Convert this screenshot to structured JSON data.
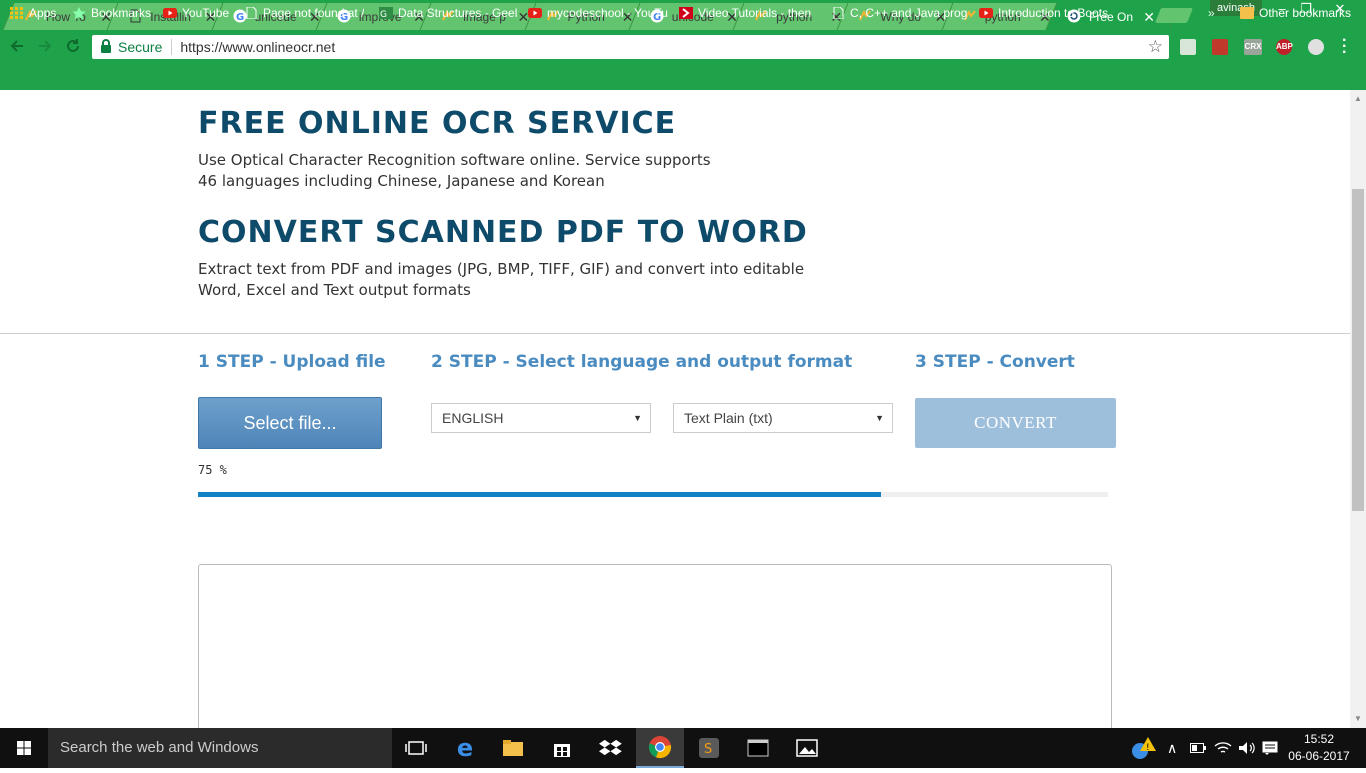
{
  "browser": {
    "tabs": [
      {
        "title": "How To",
        "icon": "python-icon",
        "active": false
      },
      {
        "title": "Installin",
        "icon": "doc-icon",
        "active": false
      },
      {
        "title": "unicode",
        "icon": "google-icon",
        "active": false
      },
      {
        "title": "improve",
        "icon": "google-icon",
        "active": false
      },
      {
        "title": "image p",
        "icon": "python-icon",
        "active": false
      },
      {
        "title": "Python",
        "icon": "python-icon",
        "active": false
      },
      {
        "title": "unicode",
        "icon": "google-icon",
        "active": false
      },
      {
        "title": "python",
        "icon": "python-icon",
        "active": false
      },
      {
        "title": "Why do",
        "icon": "python-icon",
        "active": false
      },
      {
        "title": "python",
        "icon": "python-icon",
        "active": false
      },
      {
        "title": "Free On",
        "icon": "ocr-icon",
        "active": true
      }
    ],
    "user": "avinash",
    "window_controls": {
      "minimize": "–",
      "restore": "❐",
      "close": "✕"
    },
    "address": {
      "secure_label": "Secure",
      "url": "https://www.onlineocr.net"
    },
    "extensions": [
      "CRX",
      "ABP"
    ],
    "bookmarks": [
      {
        "label": "Apps",
        "icon": "apps-icon"
      },
      {
        "label": "Bookmarks",
        "icon": "star-icon"
      },
      {
        "label": "YouTube",
        "icon": "youtube-icon"
      },
      {
        "label": "Page not found at /",
        "icon": "doc-icon"
      },
      {
        "label": "Data Structures - Geel",
        "icon": "gfg-icon"
      },
      {
        "label": "mycodeschool - YouTu",
        "icon": "youtube-icon"
      },
      {
        "label": "Video Tutorials - then",
        "icon": "chevron-icon"
      },
      {
        "label": "C, C++ and Java prog",
        "icon": "doc-icon"
      },
      {
        "label": "Introduction to Boots",
        "icon": "youtube-icon"
      }
    ],
    "bookmarks_overflow": "»",
    "other_bookmarks": "Other bookmarks"
  },
  "page": {
    "heading1": "FREE ONLINE OCR SERVICE",
    "desc1_line1": "Use Optical Character Recognition software online. Service supports",
    "desc1_line2": "46 languages including Chinese, Japanese and Korean",
    "heading2": "CONVERT SCANNED PDF TO WORD",
    "desc2_line1": "Extract text from PDF and images (JPG, BMP, TIFF, GIF) and convert into editable",
    "desc2_line2": "Word, Excel and Text output formats",
    "step1": "1 STEP - Upload file",
    "step2": "2 STEP - Select language and output format",
    "step3": "3 STEP - Convert",
    "select_file_label": "Select file...",
    "language_selected": "ENGLISH",
    "format_selected": "Text Plain (txt)",
    "convert_label": "CONVERT",
    "progress_text": "75 %",
    "progress_fraction": 0.75,
    "output_text": ""
  },
  "taskbar": {
    "search_placeholder": "Search the web and Windows",
    "time": "15:52",
    "date": "06-06-2017"
  },
  "colors": {
    "chrome_green": "#1fa34a",
    "heading_blue": "#0e4a6a",
    "step_blue": "#4a8bc0",
    "progress_blue": "#1282c4"
  }
}
